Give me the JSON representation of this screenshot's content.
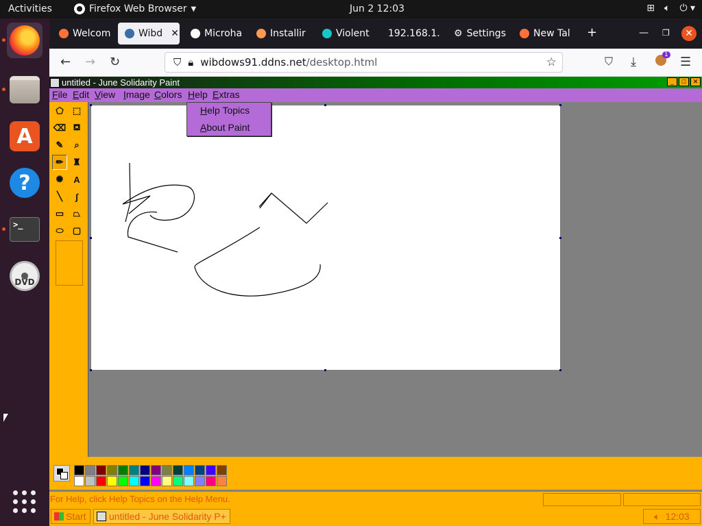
{
  "topbar": {
    "activities": "Activities",
    "app_name": "Firefox Web Browser",
    "clock": "Jun 2  12:03"
  },
  "dock": {
    "items": [
      "firefox-icon",
      "files-icon",
      "software-store-icon",
      "help-icon",
      "terminal-icon",
      "dvd-icon",
      "show-apps-icon"
    ],
    "terminal_glyph": ">_",
    "store_glyph": "A",
    "help_glyph": "?",
    "dvd_label": "DVD"
  },
  "browser": {
    "tabs": [
      {
        "label": "Welcom",
        "icon_color": "#ff7139"
      },
      {
        "label": "Wibd",
        "icon_color": "#3a6ea5"
      },
      {
        "label": "Microha",
        "icon_color": "#ffffff"
      },
      {
        "label": "Installir",
        "icon_color": "#ff9a52"
      },
      {
        "label": "Violent",
        "icon_color": "#18c8c8"
      },
      {
        "label": "192.168.1.",
        "icon_color": ""
      },
      {
        "label": "Settings",
        "icon_color": ""
      },
      {
        "label": "New Tal",
        "icon_color": "#ff7139"
      }
    ],
    "active_tab_index": 1,
    "new_tab_glyph": "+",
    "url_host": "wibdows91.ddns.net",
    "url_path": "/desktop.html",
    "extension_badge": "1"
  },
  "paint": {
    "window_title": "untitled - June Solidarity Paint",
    "menus": [
      "File",
      "Edit",
      "View",
      "Image",
      "Colors",
      "Help",
      "Extras"
    ],
    "help_menu_items": [
      "Help Topics",
      "About Paint"
    ],
    "status_message": "For Help, click Help Topics on the Help Menu.",
    "text_tool_glyph": "A",
    "palette_top": [
      "#000000",
      "#808080",
      "#800000",
      "#808000",
      "#008000",
      "#008080",
      "#000080",
      "#800080",
      "#808040",
      "#004040",
      "#0080ff",
      "#004080",
      "#4000ff",
      "#804000"
    ],
    "palette_bottom": [
      "#ffffff",
      "#c0c0c0",
      "#ff0000",
      "#ffff00",
      "#00ff00",
      "#00ffff",
      "#0000ff",
      "#ff00ff",
      "#ffff80",
      "#00ff80",
      "#80ffff",
      "#8080ff",
      "#ff0080",
      "#ff8040"
    ]
  },
  "taskbar": {
    "start_label": "Start",
    "task_label": "untitled - June Solidarity P+",
    "clock": "12:03"
  },
  "colors": {
    "menu_purple": "#b46bd8",
    "chrome_orange": "#ffb300",
    "ubuntu_orange": "#e95420"
  }
}
